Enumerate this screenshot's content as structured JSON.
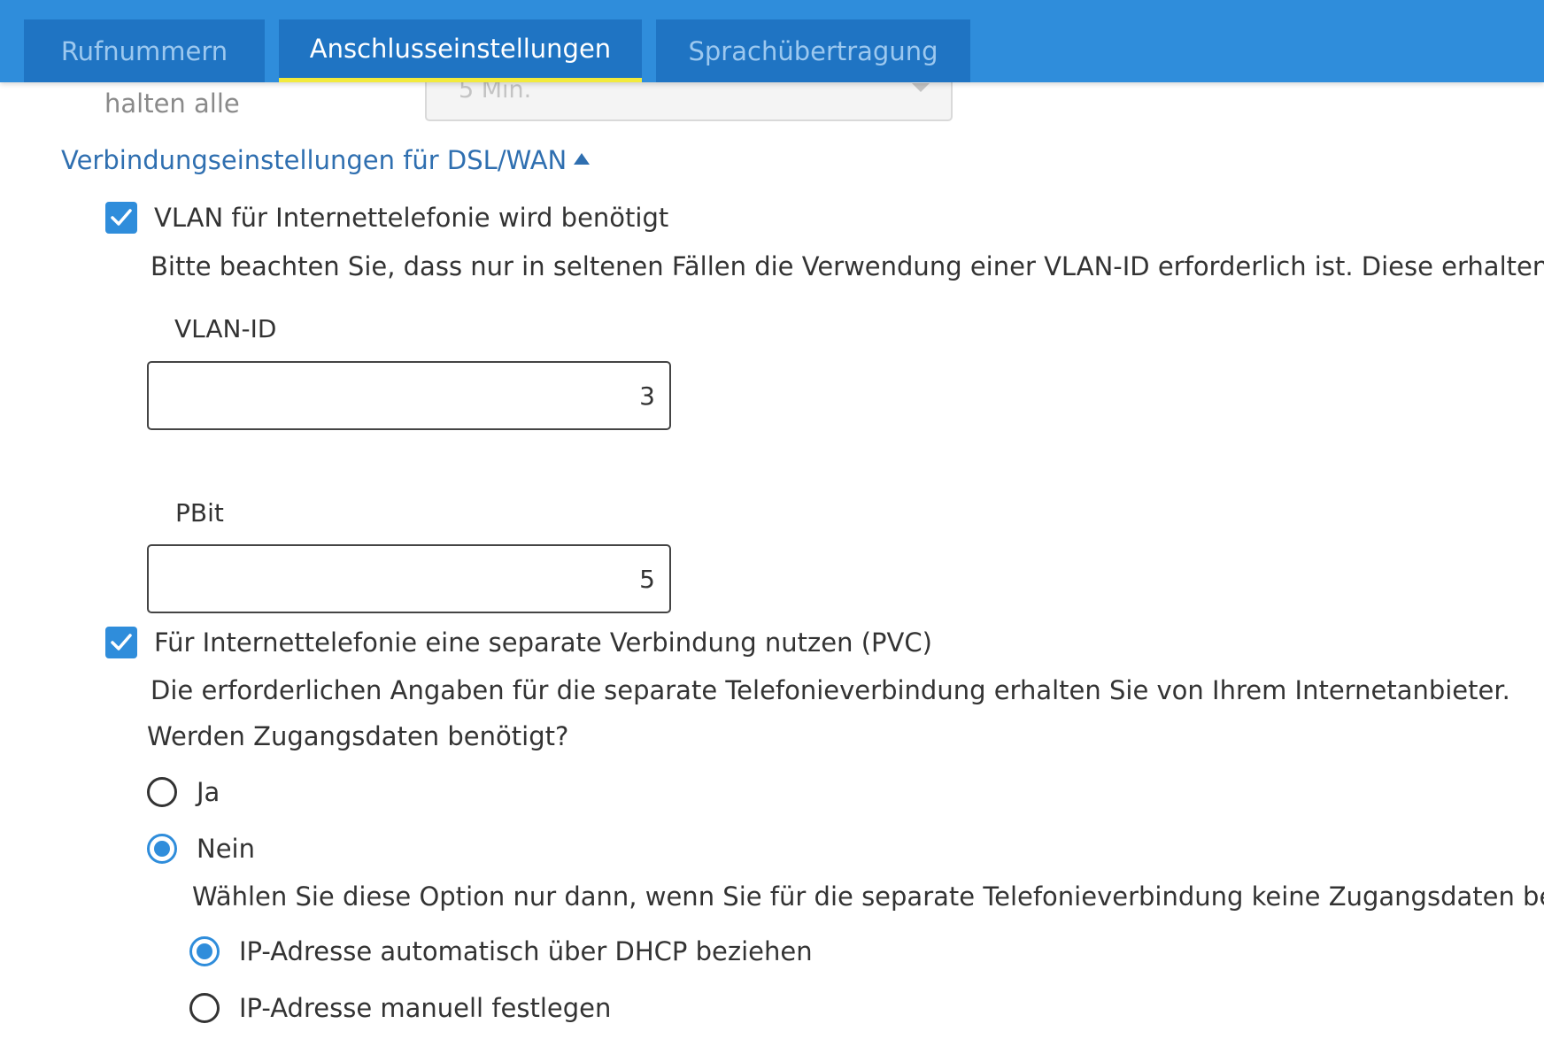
{
  "tabs": [
    {
      "label": "Rufnummern",
      "active": false
    },
    {
      "label": "Anschlusseinstellungen",
      "active": true
    },
    {
      "label": "Sprachübertragung",
      "active": false
    }
  ],
  "hidden_row": {
    "label": "halten alle",
    "select_value": "5 Min."
  },
  "section": {
    "title": "Verbindungseinstellungen für DSL/WAN"
  },
  "vlan": {
    "checkbox_label": "VLAN für Internettelefonie wird benötigt",
    "checked": true,
    "hint": "Bitte beachten Sie, dass nur in seltenen Fällen die Verwendung einer VLAN-ID erforderlich ist. Diese erhalten Sie von Ihr",
    "vlan_id_label": "VLAN-ID",
    "vlan_id_value": "3",
    "pbit_label": "PBit",
    "pbit_value": "5"
  },
  "pvc": {
    "checkbox_label": "Für Internettelefonie eine separate Verbindung nutzen (PVC)",
    "checked": true,
    "hint": "Die erforderlichen Angaben für die separate Telefonieverbindung erhalten Sie von Ihrem Internetanbieter.",
    "question": "Werden Zugangsdaten benötigt?",
    "options": [
      {
        "label": "Ja",
        "checked": false
      },
      {
        "label": "Nein",
        "checked": true
      }
    ],
    "nein_hint": "Wählen Sie diese Option nur dann, wenn Sie für die separate Telefonieverbindung keine Zugangsdaten benötigen.",
    "ip_options": [
      {
        "label": "IP-Adresse automatisch über DHCP beziehen",
        "checked": true
      },
      {
        "label": "IP-Adresse manuell festlegen",
        "checked": false
      }
    ]
  },
  "colors": {
    "tabbar": "#2f8ddb",
    "tab": "#1f74c3",
    "active_underline": "#f2ea3d",
    "link": "#2f6fb0",
    "accent": "#2f8ddb"
  }
}
